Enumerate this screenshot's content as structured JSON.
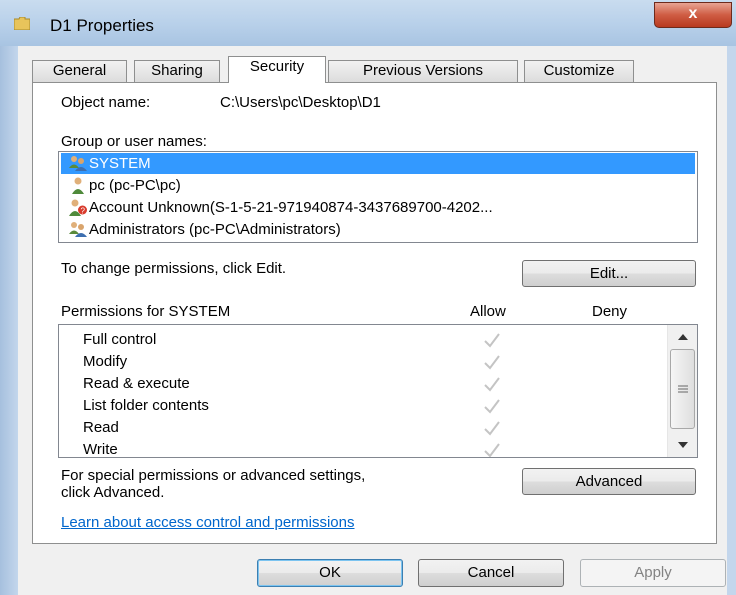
{
  "window": {
    "title": "D1 Properties",
    "close_label": "x"
  },
  "tabs": [
    {
      "label": "General",
      "active": false
    },
    {
      "label": "Sharing",
      "active": false
    },
    {
      "label": "Security",
      "active": true
    },
    {
      "label": "Previous Versions",
      "active": false
    },
    {
      "label": "Customize",
      "active": false
    }
  ],
  "security": {
    "object_name_label": "Object name:",
    "object_name_value": "C:\\Users\\pc\\Desktop\\D1",
    "group_label": "Group or user names:",
    "users": [
      {
        "name": "SYSTEM",
        "icon": "user-group-icon",
        "selected": true
      },
      {
        "name": "pc (pc-PC\\pc)",
        "icon": "user-icon",
        "selected": false
      },
      {
        "name": "Account Unknown(S-1-5-21-971940874-3437689700-4202...",
        "icon": "unknown-user-icon",
        "selected": false
      },
      {
        "name": "Administrators (pc-PC\\Administrators)",
        "icon": "user-group-icon",
        "selected": false
      }
    ],
    "change_text": "To change permissions, click Edit.",
    "edit_label": "Edit...",
    "permissions_for": "Permissions for SYSTEM",
    "allow_header": "Allow",
    "deny_header": "Deny",
    "permissions": [
      {
        "name": "Full control",
        "allow": true,
        "deny": false
      },
      {
        "name": "Modify",
        "allow": true,
        "deny": false
      },
      {
        "name": "Read & execute",
        "allow": true,
        "deny": false
      },
      {
        "name": "List folder contents",
        "allow": true,
        "deny": false
      },
      {
        "name": "Read",
        "allow": true,
        "deny": false
      },
      {
        "name": "Write",
        "allow": true,
        "deny": false
      }
    ],
    "special_text_1": "For special permissions or advanced settings,",
    "special_text_2": "click Advanced.",
    "advanced_label": "Advanced",
    "learn_link": "Learn about access control and permissions"
  },
  "footer": {
    "ok_label": "OK",
    "cancel_label": "Cancel",
    "apply_label": "Apply"
  },
  "colors": {
    "selection": "#3399ff",
    "link": "#0066cc",
    "check": "#c4c4c4"
  }
}
